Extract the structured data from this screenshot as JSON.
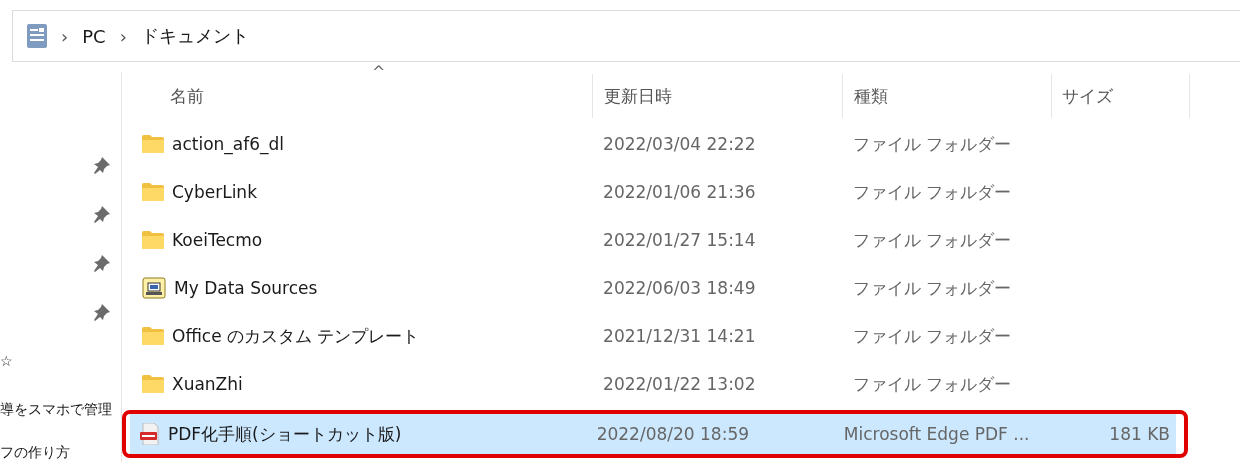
{
  "address_bar": {
    "path": [
      "PC",
      "ドキュメント"
    ],
    "separators": [
      "›",
      "›"
    ]
  },
  "nav_pane": {
    "items": [
      {
        "kind": "pinned"
      },
      {
        "kind": "pinned"
      },
      {
        "kind": "pinned"
      },
      {
        "kind": "pinned"
      },
      {
        "kind": "text",
        "label": "☆"
      },
      {
        "kind": "text",
        "label": "導をスマホで管理"
      },
      {
        "kind": "text",
        "label": "フの作り方"
      }
    ]
  },
  "table": {
    "sort_indicator": "^",
    "columns": [
      "名前",
      "更新日時",
      "種類",
      "サイズ"
    ],
    "rows": [
      {
        "kind": "folder",
        "name": "action_af6_dl",
        "modified": "2022/03/04 22:22",
        "type": "ファイル フォルダー",
        "selected": false,
        "highlighted": false
      },
      {
        "kind": "folder",
        "name": "CyberLink",
        "modified": "2022/01/06 21:36",
        "type": "ファイル フォルダー",
        "selected": false,
        "highlighted": false
      },
      {
        "kind": "folder",
        "name": "KoeiTecmo",
        "modified": "2022/01/27 15:14",
        "type": "ファイル フォルダー",
        "selected": false,
        "highlighted": false
      },
      {
        "kind": "datasource",
        "name": "My Data Sources",
        "modified": "2022/06/03 18:49",
        "type": "ファイル フォルダー",
        "selected": false,
        "highlighted": false
      },
      {
        "kind": "folder",
        "name": "Office のカスタム テンプレート",
        "modified": "2021/12/31 14:21",
        "type": "ファイル フォルダー",
        "selected": false,
        "highlighted": false
      },
      {
        "kind": "folder",
        "name": "XuanZhi",
        "modified": "2022/01/22 13:02",
        "type": "ファイル フォルダー",
        "selected": false,
        "highlighted": false
      },
      {
        "kind": "pdf",
        "name": "PDF化手順(ショートカット版)",
        "modified": "2022/08/20 18:59",
        "type": "Microsoft Edge PDF ...",
        "size": "181 KB",
        "selected": true,
        "highlighted": true
      }
    ]
  }
}
